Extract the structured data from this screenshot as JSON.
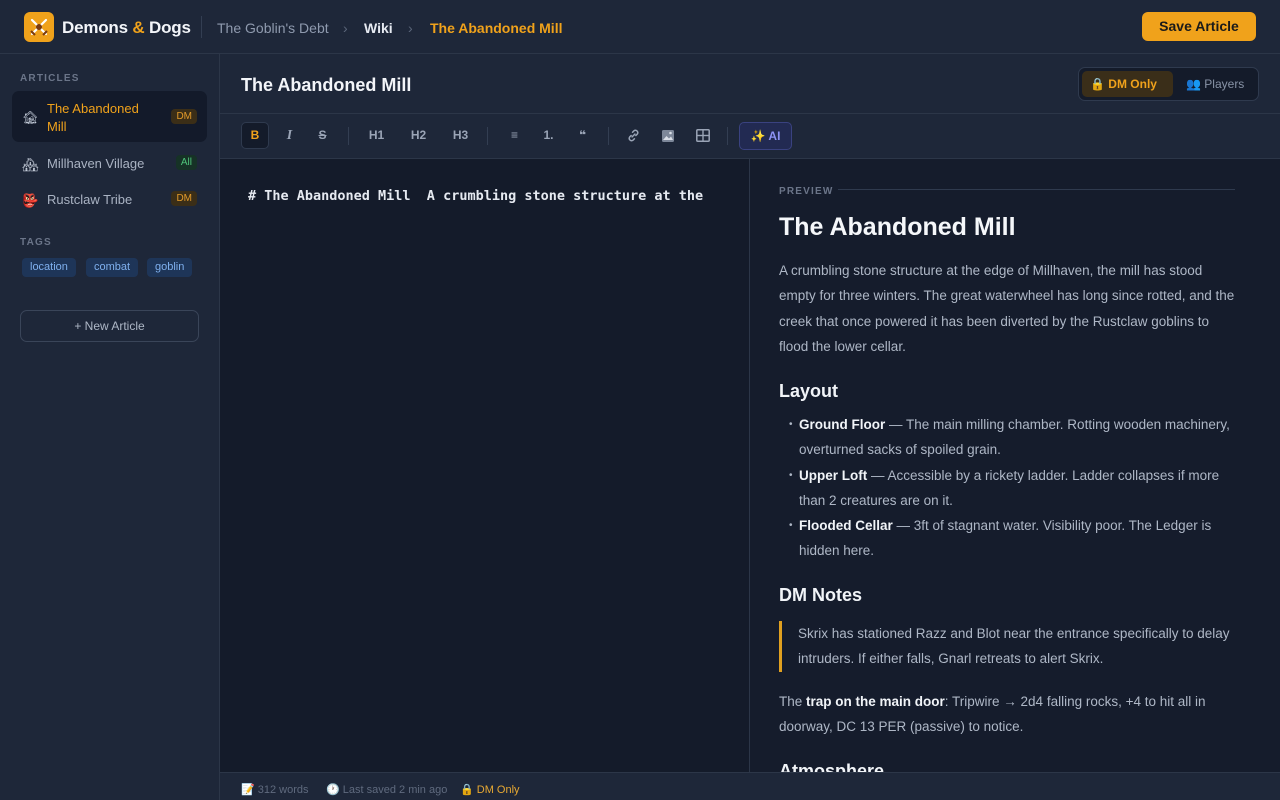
{
  "header": {
    "brand_name_1": "Demons",
    "brand_amp": "&",
    "brand_name_2": "Dogs",
    "breadcrumb": [
      "The Goblin's Debt",
      "Wiki",
      "The Abandoned Mill"
    ],
    "breadcrumb_sep": "›",
    "save_label": "Save Article",
    "accent_color": "#f0a21b"
  },
  "sidebar": {
    "articles_label": "ARTICLES",
    "articles": [
      {
        "label": "The Abandoned Mill",
        "badge": "DM",
        "icon": "building-icon",
        "active": true
      },
      {
        "label": "Millhaven Village",
        "badge": "All",
        "icon": "village-icon",
        "active": false
      },
      {
        "label": "Rustclaw Tribe",
        "badge": "DM",
        "icon": "goblin-face-icon",
        "active": false
      }
    ],
    "tags_label": "TAGS",
    "tags": [
      "location",
      "combat",
      "goblin"
    ],
    "new_article_label": "+ New Article"
  },
  "article": {
    "title": "The Abandoned Mill",
    "visibility_options": [
      "DM Only",
      "Players"
    ],
    "visibility_selected": "DM Only"
  },
  "toolbar": {
    "bold": "B",
    "italic": "I",
    "strike": "S",
    "h1": "H1",
    "h2": "H2",
    "h3": "H3",
    "bullet_list": "≡",
    "ordered_list": "1.",
    "quote": "❝",
    "ai_label": "AI"
  },
  "editor": {
    "content": "# The Abandoned Mill  A crumbling stone structure at the edge of Millhaven"
  },
  "preview": {
    "label": "PREVIEW",
    "h1": "The Abandoned Mill",
    "intro": "A crumbling stone structure at the edge of Millhaven, the mill has stood empty for three winters. The great waterwheel has long since rotted, and the creek that once powered it has been diverted by the Rustclaw goblins to flood the lower cellar.",
    "layout_heading": "Layout",
    "layout_items": [
      {
        "title": "Ground Floor",
        "text": " — The main milling chamber. Rotting wooden machinery, overturned sacks of spoiled grain."
      },
      {
        "title": "Upper Loft",
        "text": " — Accessible by a rickety ladder. Ladder collapses if more than 2 creatures are on it."
      },
      {
        "title": "Flooded Cellar",
        "text": " — 3ft of stagnant water. Visibility poor. The Ledger is hidden here."
      }
    ],
    "dm_notes_heading": "DM Notes",
    "dm_quote": "Skrix has stationed Razz and Blot near the entrance specifically to delay intruders. If either falls, Gnarl retreats to alert Skrix.",
    "trap_prefix": "The ",
    "trap_bold": "trap on the main door",
    "trap_text": ": Tripwire → 2d4 falling rocks, +4 to hit all in doorway, DC 13 PER (passive) to notice.",
    "atmosphere_heading": "Atmosphere"
  },
  "status": {
    "words": "312 words",
    "saved": "Last saved 2 min ago",
    "visibility": "DM Only"
  }
}
